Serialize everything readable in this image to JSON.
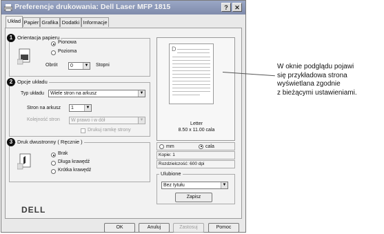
{
  "window": {
    "title": "Preferencje drukowania: Dell Laser MFP 1815",
    "help_button": "?",
    "close_button": "✕"
  },
  "tabs": [
    "Układ",
    "Papier",
    "Grafika",
    "Dodatki",
    "Informacje"
  ],
  "markers": [
    "1",
    "2",
    "3"
  ],
  "orientation": {
    "title": "Orientacja papieru",
    "portrait_label": "Pionowa",
    "landscape_label": "Pozioma",
    "selected": "Pionowa",
    "rotate_label": "Obrót",
    "rotate_value": "0",
    "rotate_unit": "Stopni"
  },
  "layout_options": {
    "title": "Opcje układu",
    "type_label": "Typ układu",
    "type_value": "Wiele stron na arkusz",
    "pages_label": "Stron na arkusz",
    "pages_value": "1",
    "order_label": "Kolejność stron",
    "order_value": "W prawo i w dół",
    "border_label": "Drukuj ramkę strony"
  },
  "duplex": {
    "title": "Druk dwustronny ( Ręcznie )",
    "none_label": "Brak",
    "long_label": "Dluga krawędź",
    "short_label": "Krótka krawędź",
    "selected": "Brak"
  },
  "preview": {
    "paper_letter": "D",
    "paper_name": "Letter",
    "paper_size": "8.50 x 11.00 cala",
    "unit_mm": "mm",
    "unit_inch": "cala",
    "selected_unit": "cala",
    "copies": "Kopie: 1",
    "resolution": "Rozdzielczość: 600 dpi"
  },
  "favorites": {
    "title": "Ulubione",
    "value": "Bez tytułu",
    "save_label": "Zapisz"
  },
  "logo": "DELL",
  "buttons": {
    "ok": "OK",
    "cancel": "Anuluj",
    "apply": "Zastosuj",
    "help": "Pomoc"
  },
  "callout": {
    "line1": "W oknie podglądu pojawi",
    "line2": "się przykładowa strona",
    "line3": "wyświetlana zgodnie",
    "line4": "z bieżącymi ustawieniami."
  }
}
